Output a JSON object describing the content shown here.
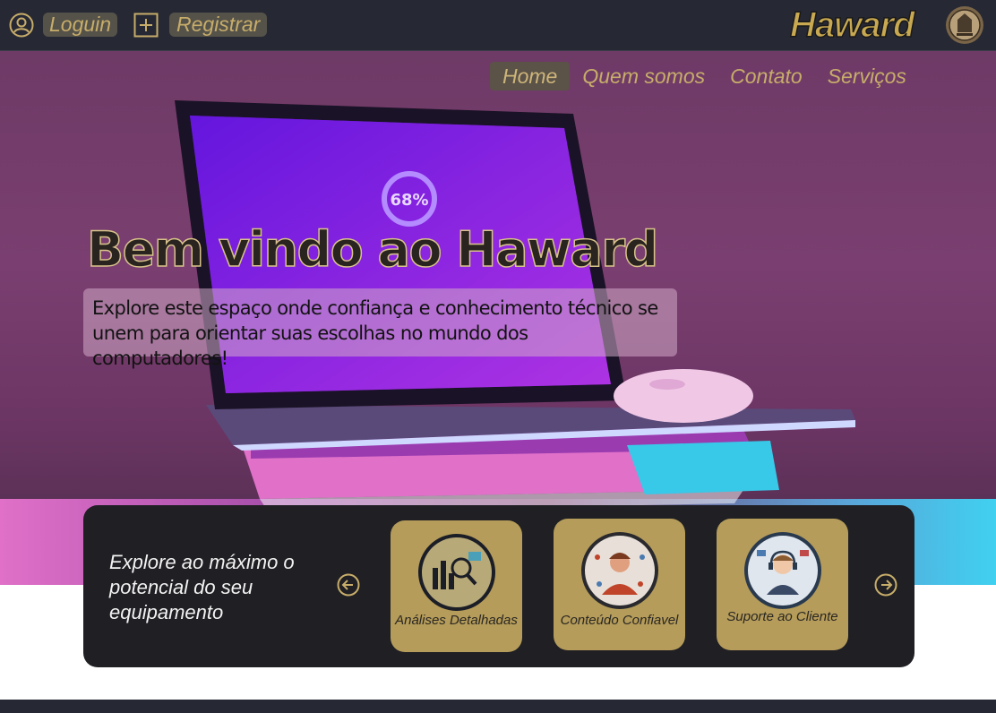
{
  "topbar": {
    "login_label": "Loguin",
    "register_label": "Registrar",
    "brand": "Haward",
    "icons": {
      "user": "user-circle-icon",
      "plus": "plus-square-icon",
      "seal": "brand-seal-icon"
    }
  },
  "nav": {
    "items": [
      {
        "label": "Home",
        "active": true
      },
      {
        "label": "Quem somos",
        "active": false
      },
      {
        "label": "Contato",
        "active": false
      },
      {
        "label": "Serviços",
        "active": false
      }
    ]
  },
  "hero": {
    "title": "Bem vindo ao Haward",
    "subtitle": "Explore este espaço onde confiança e conhecimento técnico se unem para orientar suas escolhas no mundo dos computadores!",
    "screen_text": "68%"
  },
  "features": {
    "intro": "Explore ao máximo o potencial do seu equipamento",
    "cards": [
      {
        "label": "Análises Detalhadas",
        "icon": "analysis-icon"
      },
      {
        "label": "Conteúdo Confiavel",
        "icon": "expert-icon"
      },
      {
        "label": "Suporte ao Cliente",
        "icon": "support-agent-icon"
      }
    ]
  },
  "colors": {
    "topbar_bg": "#262834",
    "accent_gold": "#c7ad6a",
    "card_gold": "#b59c5a",
    "panel_bg": "#1f1f24"
  }
}
